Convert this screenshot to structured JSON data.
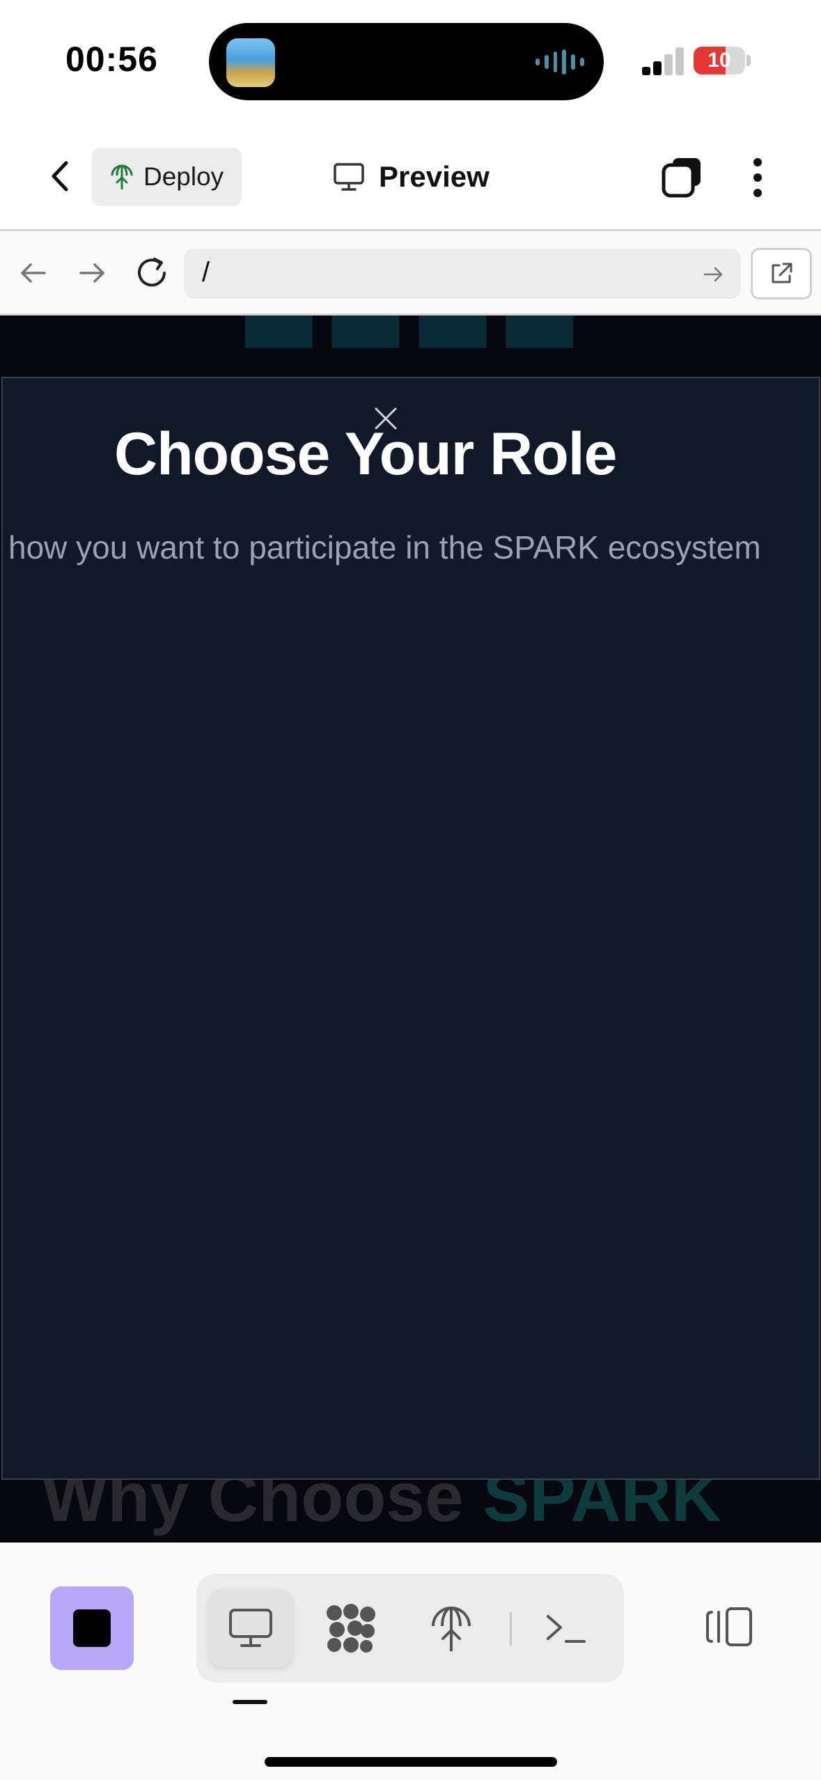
{
  "status_bar": {
    "time": "00:56",
    "battery_text": "10",
    "battery_level_percent": 10,
    "battery_color": "#e53935",
    "icons": [
      "live-activity-app-icon",
      "audio-waveform-icon",
      "cellular-signal-icon",
      "battery-icon"
    ]
  },
  "toolbar": {
    "back_icon": "chevron-left-icon",
    "deploy_label": "Deploy",
    "deploy_icon": "deploy-globe-icon",
    "preview_label": "Preview",
    "preview_icon": "monitor-icon",
    "tabs_icon": "tabs-stack-icon",
    "more_icon": "more-vertical-icon"
  },
  "url_bar": {
    "value": "/",
    "back_icon": "arrow-left-icon",
    "forward_icon": "arrow-right-icon",
    "reload_icon": "reload-icon",
    "go_icon": "arrow-right-small-icon",
    "open_external_icon": "external-link-icon"
  },
  "web_content": {
    "modal": {
      "title": "Choose Your Role",
      "subtitle": "how you want to participate in the SPARK ecosystem",
      "close_icon": "close-icon",
      "background": "#111827"
    },
    "background_text": {
      "why_prefix": "Why Choose",
      "why_accent": "SPARK"
    }
  },
  "bottom_bar": {
    "stop_color": "#b9a8f7",
    "tabs": [
      {
        "name": "preview",
        "icon": "monitor-icon",
        "active": true
      },
      {
        "name": "agents",
        "icon": "cluster-icon",
        "active": false
      },
      {
        "name": "deploy",
        "icon": "deploy-globe-icon",
        "active": false
      },
      {
        "name": "console",
        "icon": "terminal-icon",
        "active": false
      }
    ],
    "panel_icon": "panel-toggle-icon"
  }
}
